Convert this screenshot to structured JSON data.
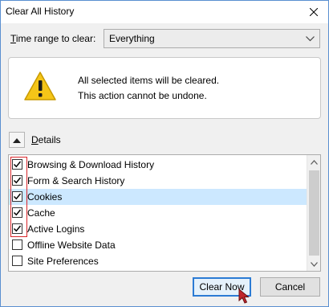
{
  "window": {
    "title": "Clear All History"
  },
  "time_range": {
    "label_mnemonic": "T",
    "label_rest": "ime range to clear:",
    "selected": "Everything"
  },
  "warning": {
    "line1": "All selected items will be cleared.",
    "line2": "This action cannot be undone."
  },
  "details": {
    "label_mnemonic": "D",
    "label_rest": "etails"
  },
  "items": [
    {
      "label": "Browsing & Download History",
      "checked": true,
      "selected": false
    },
    {
      "label": "Form & Search History",
      "checked": true,
      "selected": false
    },
    {
      "label": "Cookies",
      "checked": true,
      "selected": true
    },
    {
      "label": "Cache",
      "checked": true,
      "selected": false
    },
    {
      "label": "Active Logins",
      "checked": true,
      "selected": false
    },
    {
      "label": "Offline Website Data",
      "checked": false,
      "selected": false
    },
    {
      "label": "Site Preferences",
      "checked": false,
      "selected": false
    }
  ],
  "buttons": {
    "clear_now": "Clear Now",
    "cancel": "Cancel"
  },
  "colors": {
    "selection": "#cce8ff",
    "focus_border": "#2c7bd4",
    "highlight": "#d9262a",
    "warning_yellow": "#f5c518",
    "cursor": "#c0262c"
  }
}
